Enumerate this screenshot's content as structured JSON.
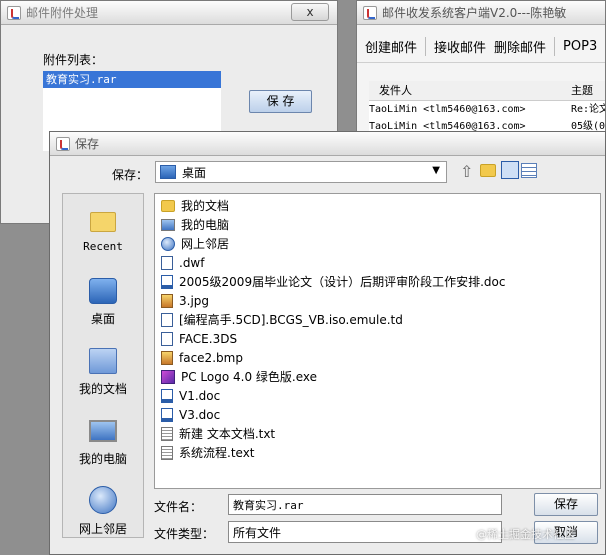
{
  "attach_window": {
    "title": "邮件附件处理",
    "close_label": "x",
    "list_label": "附件列表：",
    "attachments": [
      "教育实习.rar"
    ],
    "save_button": "保 存"
  },
  "mail_window": {
    "title": "邮件收发系统客户端V2.0---陈艳敏",
    "menu": [
      "创建邮件",
      "接收邮件",
      "删除邮件",
      "POP3"
    ],
    "columns": [
      "发件人",
      "主题"
    ],
    "rows": [
      {
        "sender": "TaoLiMin <tlm5460@163.com>",
        "subject": "Re:论文"
      },
      {
        "sender": "TaoLiMin <tlm5460@163.com>",
        "subject": "05级(0"
      }
    ]
  },
  "save_dialog": {
    "title": "保存",
    "look_in_label": "保存：",
    "look_in_value": "桌面",
    "places": [
      {
        "label": "Recent",
        "icon": "recent-folder-icon"
      },
      {
        "label": "桌面",
        "icon": "desktop-icon"
      },
      {
        "label": "我的文档",
        "icon": "my-documents-icon"
      },
      {
        "label": "我的电脑",
        "icon": "my-computer-icon"
      },
      {
        "label": "网上邻居",
        "icon": "network-icon"
      }
    ],
    "files": [
      {
        "name": "我的文档",
        "icon": "folder-icon"
      },
      {
        "name": "我的电脑",
        "icon": "computer-icon"
      },
      {
        "name": "网上邻居",
        "icon": "network-icon"
      },
      {
        "name": ".dwf",
        "icon": "file-icon"
      },
      {
        "name": "2005级2009届毕业论文（设计）后期评审阶段工作安排.doc",
        "icon": "word-doc-icon"
      },
      {
        "name": "3.jpg",
        "icon": "image-icon"
      },
      {
        "name": "[编程高手.5CD].BCGS_VB.iso.emule.td",
        "icon": "file-icon"
      },
      {
        "name": "FACE.3DS",
        "icon": "file-icon"
      },
      {
        "name": "face2.bmp",
        "icon": "image-icon"
      },
      {
        "name": "PC Logo 4.0 绿色版.exe",
        "icon": "exe-icon"
      },
      {
        "name": "V1.doc",
        "icon": "word-doc-icon"
      },
      {
        "name": "V3.doc",
        "icon": "word-doc-icon"
      },
      {
        "name": "新建 文本文档.txt",
        "icon": "text-file-icon"
      },
      {
        "name": "系统流程.text",
        "icon": "text-file-icon"
      }
    ],
    "filename_label": "文件名：",
    "filename_value": "教育实习.rar",
    "filetype_label": "文件类型：",
    "filetype_value": "所有文件",
    "save_button": "保存",
    "cancel_button": "取消",
    "watermark": "@稀土掘金技术社区"
  }
}
